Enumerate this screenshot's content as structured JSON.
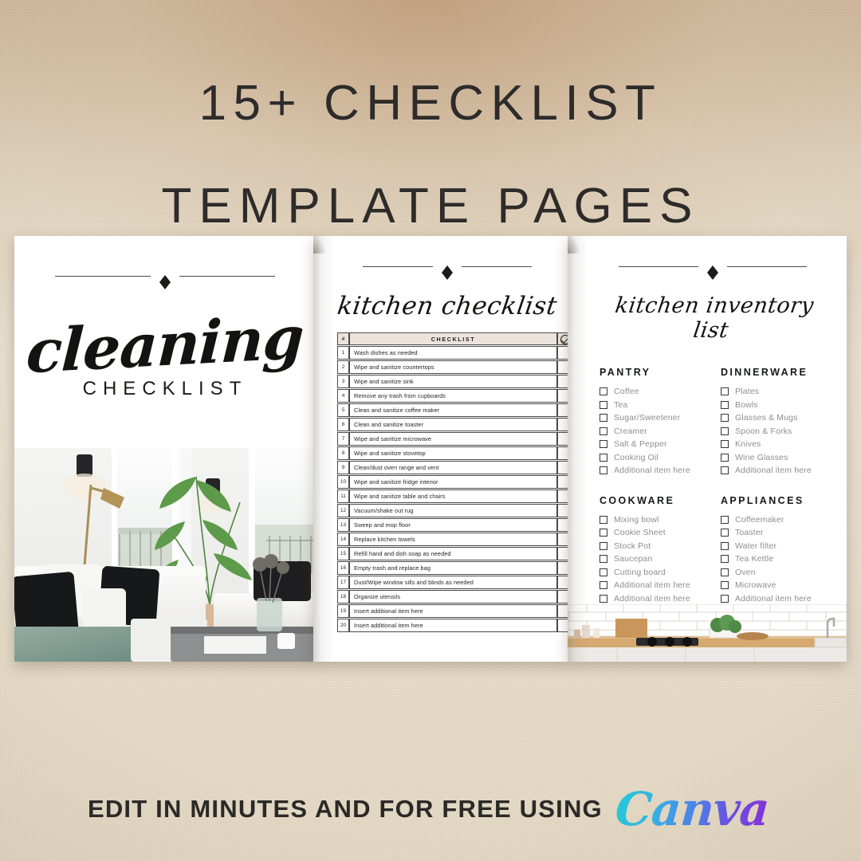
{
  "theme": {
    "background_color": "#e9e0ce",
    "background_top_color": "#d6bfa4",
    "page_color": "#ffffff",
    "ink_color": "#1c1b1a",
    "table_header_fill": "#ece4dc",
    "muted_text_color": "#8d8e90",
    "canva_gradient_start": "#25c8d8",
    "canva_gradient_mid": "#4a86e8",
    "canva_gradient_end": "#8c2bd6"
  },
  "headline": {
    "line1": "15+ CHECKLIST",
    "line2": "TEMPLATE PAGES"
  },
  "cover_page": {
    "ornament_icon": "diamond-divider-icon",
    "script_title": "cleaning",
    "sub_title": "CHECKLIST",
    "photo_alt": "living-room-photo"
  },
  "checklist_page": {
    "ornament_icon": "diamond-divider-icon",
    "script_title": "kitchen checklist",
    "table": {
      "columns": [
        "#",
        "CHECKLIST",
        "check-circle-icon"
      ],
      "rows": [
        {
          "num": "1",
          "task": "Wash dishes as needed",
          "checked": false
        },
        {
          "num": "2",
          "task": "Wipe and sanitize countertops",
          "checked": false
        },
        {
          "num": "3",
          "task": "Wipe and sanitize sink",
          "checked": false
        },
        {
          "num": "4",
          "task": "Remove any trash from cupboards",
          "checked": false
        },
        {
          "num": "5",
          "task": "Clean and sanitize coffee maker",
          "checked": false
        },
        {
          "num": "6",
          "task": "Clean and sanitize toaster",
          "checked": false
        },
        {
          "num": "7",
          "task": "Wipe and sanitize microwave",
          "checked": false
        },
        {
          "num": "8",
          "task": "Wipe and sanitize stovetop",
          "checked": false
        },
        {
          "num": "9",
          "task": "Clean/dust oven range and vent",
          "checked": false
        },
        {
          "num": "10",
          "task": "Wipe and sanitize fridge interior",
          "checked": false
        },
        {
          "num": "11",
          "task": "Wipe and sanitize table and chairs",
          "checked": false
        },
        {
          "num": "12",
          "task": "Vacuum/shake out rug",
          "checked": false
        },
        {
          "num": "13",
          "task": "Sweep and mop floor",
          "checked": false
        },
        {
          "num": "14",
          "task": "Replace kitchen towels",
          "checked": false
        },
        {
          "num": "15",
          "task": "Refill hand and dish soap as needed",
          "checked": false
        },
        {
          "num": "16",
          "task": "Empty trash and replace bag",
          "checked": false
        },
        {
          "num": "17",
          "task": "Dust/Wipe window sills and blinds as needed",
          "checked": false
        },
        {
          "num": "18",
          "task": "Organize utensils",
          "checked": false
        },
        {
          "num": "19",
          "task": "Insert additional item here",
          "checked": false
        },
        {
          "num": "20",
          "task": "Insert additional item here",
          "checked": false
        }
      ]
    }
  },
  "inventory_page": {
    "ornament_icon": "diamond-divider-icon",
    "script_title": "kitchen inventory list",
    "sections": [
      {
        "heading": "PANTRY",
        "items": [
          "Coffee",
          "Tea",
          "Sugar/Sweetener",
          "Creamer",
          "Salt & Pepper",
          "Cooking Oil",
          "Additional item here"
        ]
      },
      {
        "heading": "DINNERWARE",
        "items": [
          "Plates",
          "Bowls",
          "Glasses & Mugs",
          "Spoon & Forks",
          "Knives",
          "Wine Glasses",
          "Additional item here"
        ]
      },
      {
        "heading": "COOKWARE",
        "items": [
          "Mixing bowl",
          "Cookie Sheet",
          "Stock Pot",
          "Saucepan",
          "Cutting board",
          "Additional item here",
          "Additional item here"
        ]
      },
      {
        "heading": "APPLIANCES",
        "items": [
          "Coffeemaker",
          "Toaster",
          "Water filter",
          "Tea Kettle",
          "Oven",
          "Microwave",
          "Additional item here"
        ]
      }
    ],
    "photo_alt": "kitchen-counter-photo"
  },
  "footer": {
    "caption": "EDIT IN MINUTES AND FOR FREE USING",
    "brand": "Canva"
  }
}
